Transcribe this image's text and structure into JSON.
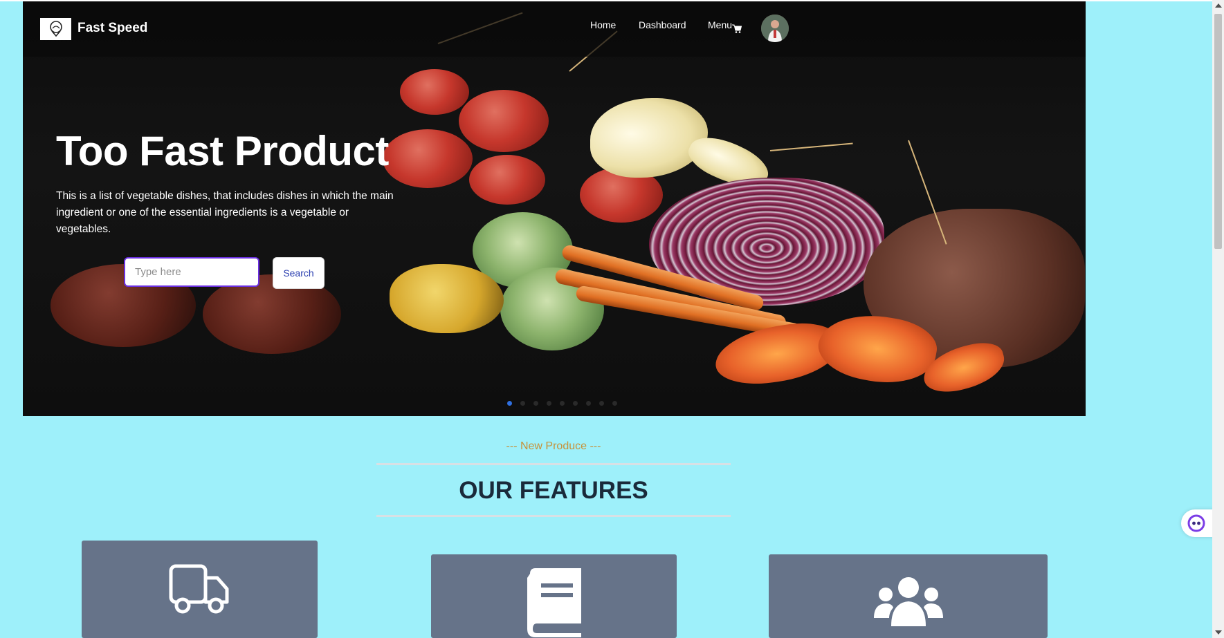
{
  "brand": {
    "name": "Fast Speed",
    "logo_icon": "location-pin-icon"
  },
  "nav": {
    "links": [
      "Home",
      "Dashboard",
      "Menu"
    ],
    "cart_icon": "cart-icon"
  },
  "hero": {
    "title": "Too Fast Product",
    "description": "This is a list of vegetable dishes, that includes dishes in which the main ingredient or one of the essential ingredients is a vegetable or vegetables.",
    "search_placeholder": "Type here",
    "search_button": "Search",
    "active_slide": 1
  },
  "features": {
    "eyebrow": "--- New Produce ---",
    "title": "OUR FEATURES",
    "cards": [
      {
        "icon": "truck-icon"
      },
      {
        "icon": "book-icon"
      },
      {
        "icon": "users-icon"
      }
    ]
  },
  "colors": {
    "page_bg": "#9ef0fa",
    "card_bg": "#667389",
    "accent": "#6a2fe0",
    "eyebrow": "#c6923a"
  }
}
